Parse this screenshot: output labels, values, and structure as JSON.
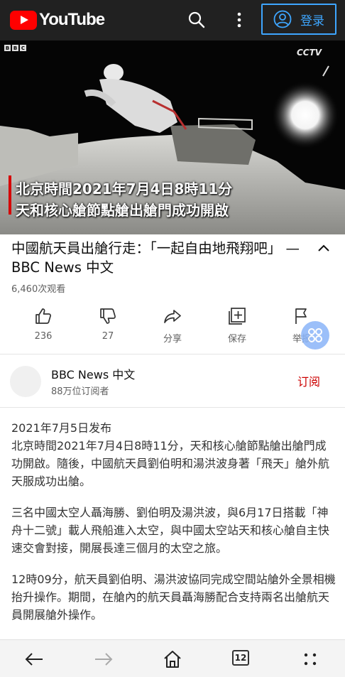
{
  "topbar": {
    "logo_text": "YouTube",
    "login_label": "登录",
    "brand_color": "#ff0000",
    "login_color": "#3ea6ff"
  },
  "video": {
    "watermark_left": "BBC",
    "watermark_right": "CCTV",
    "caption_line1": "北京時間2021年7月4日8時11分",
    "caption_line2": "天和核心艙節點艙出艙門成功開啟"
  },
  "video_info": {
    "title": "中國航天員出艙行走：「一起自由地飛翔吧」 — BBC News 中文",
    "views": "6,460次观看"
  },
  "actions": {
    "like_count": "236",
    "dislike_count": "27",
    "share_label": "分享",
    "save_label": "保存",
    "report_label": "举报"
  },
  "channel": {
    "name": "BBC News 中文",
    "subscribers": "88万位订阅者",
    "subscribe_label": "订阅"
  },
  "description": {
    "date": "2021年7月5日发布",
    "p1": "北京時間2021年7月4日8時11分，天和核心艙節點艙出艙門成功開啟。隨後，中國航天員劉伯明和湯洪波身著「飛天」艙外航天服成功出艙。",
    "p2": "三名中國太空人聶海勝、劉伯明及湯洪波，與6月17日搭載「神舟十二號」載人飛船進入太空，與中國太空站天和核心艙自主快速交會對接，開展長達三個月的太空之旅。",
    "p3": "12時09分，航天員劉伯明、湯洪波協同完成空間站艙外全景相機抬升操作。期間，在艙內的航天員聶海勝配合支持兩名出艙航天員開展艙外操作。"
  },
  "browser_nav": {
    "tab_count": "12"
  }
}
